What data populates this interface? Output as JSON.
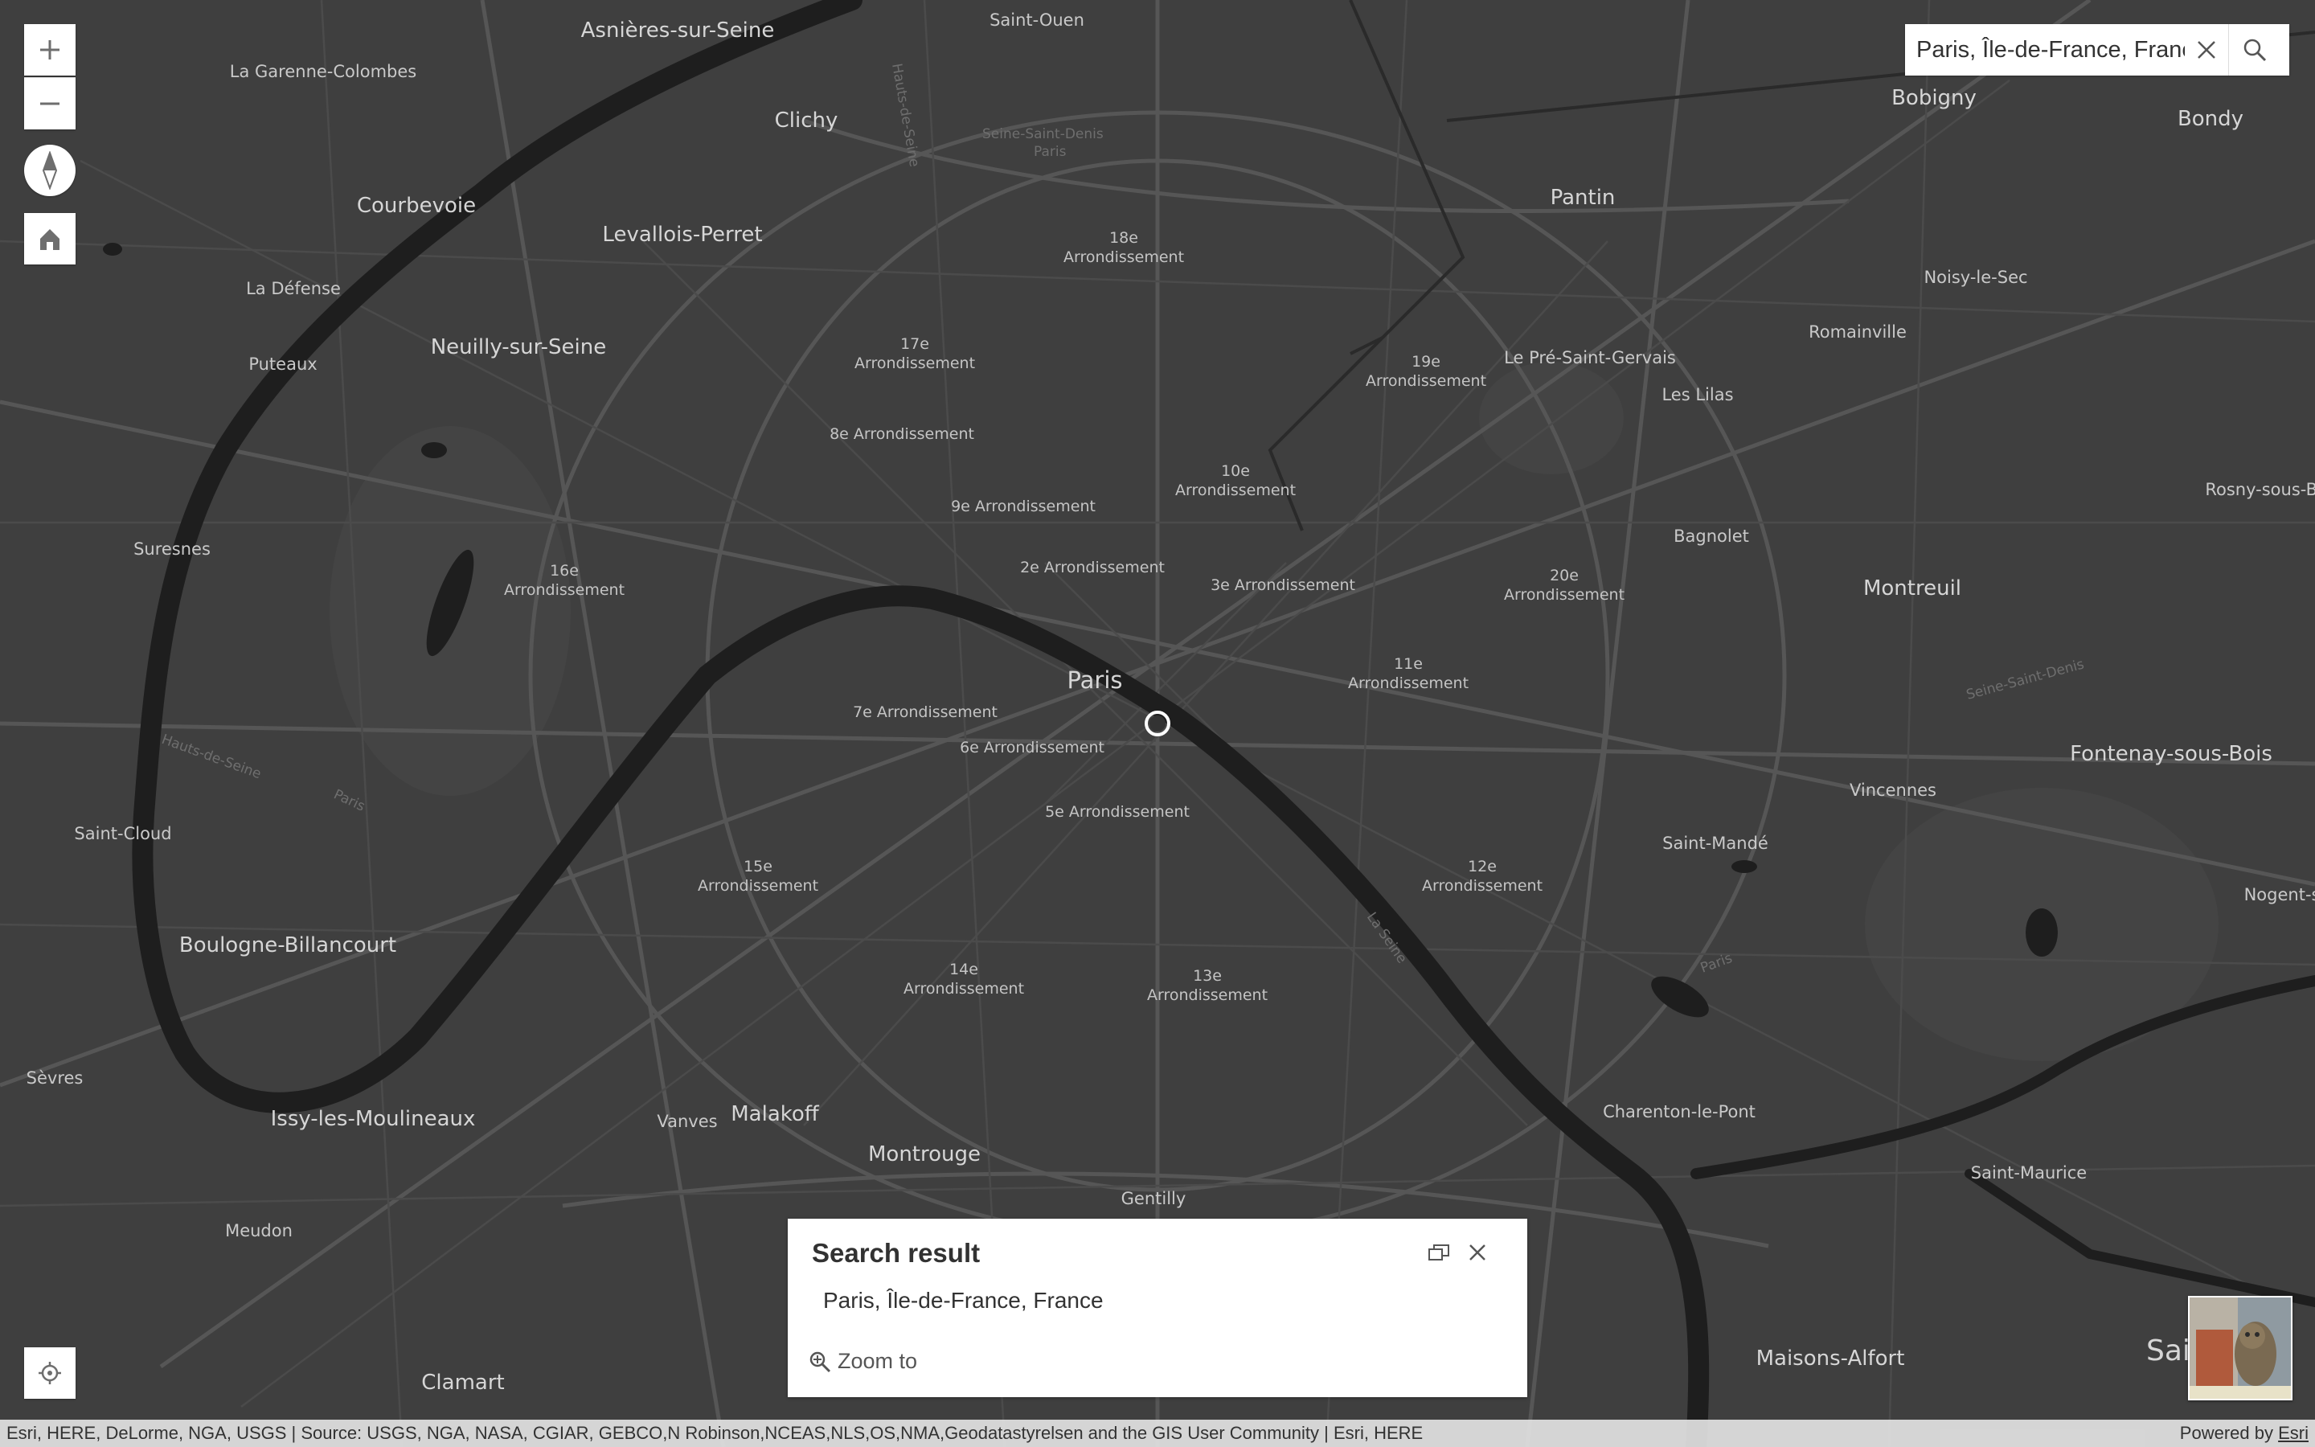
{
  "map": {
    "colors": {
      "background": "#3f3f3f",
      "water": "#1e1e1e",
      "roads": "#555555",
      "label": "#c9c9c9"
    },
    "labels": {
      "asnieres": "Asnières-sur-Seine",
      "saint_ouen": "Saint-Ouen",
      "garenne": "La Garenne-Colombes",
      "clichy": "Clichy",
      "bobigny": "Bobigny",
      "bondy": "Bondy",
      "courbevoie": "Courbevoie",
      "levallois": "Levallois-Perret",
      "pantin": "Pantin",
      "defense": "La Défense",
      "noisy": "Noisy-le-Sec",
      "neuilly": "Neuilly-sur-Seine",
      "puteaux": "Puteaux",
      "pre_st_gervais": "Le Pré-Saint-Gervais",
      "romainville": "Romainville",
      "les_lilas": "Les Lilas",
      "rosny": "Rosny-sous-Bois",
      "suresnes": "Suresnes",
      "bagnolet": "Bagnolet",
      "montreuil": "Montreuil",
      "paris": "Paris",
      "fontenay": "Fontenay-sous-Bois",
      "vincennes": "Vincennes",
      "saint_cloud": "Saint-Cloud",
      "saint_mande": "Saint-Mandé",
      "nogent": "Nogent-sur",
      "boulogne": "Boulogne-Billancourt",
      "sevres": "Sèvres",
      "issy": "Issy-les-Moulineaux",
      "vanves": "Vanves",
      "malakoff": "Malakoff",
      "montrouge": "Montrouge",
      "charenton": "Charenton-le-Pont",
      "saint_maurice": "Saint-Maurice",
      "meudon": "Meudon",
      "gentilly": "Gentilly",
      "maisons_alfort": "Maisons-Alfort",
      "saint_big": "Saint-",
      "clamart": "Clamart",
      "arr_18_a": "18e",
      "arr_18_b": "Arrondissement",
      "arr_17_a": "17e",
      "arr_17_b": "Arrondissement",
      "arr_19_a": "19e",
      "arr_19_b": "Arrondissement",
      "arr_8": "8e Arrondissement",
      "arr_10_a": "10e",
      "arr_10_b": "Arrondissement",
      "arr_9": "9e Arrondissement",
      "arr_16_a": "16e",
      "arr_16_b": "Arrondissement",
      "arr_2": "2e Arrondissement",
      "arr_3": "3e Arrondissement",
      "arr_20_a": "20e",
      "arr_20_b": "Arrondissement",
      "arr_11_a": "11e",
      "arr_11_b": "Arrondissement",
      "arr_7": "7e Arrondissement",
      "arr_6": "6e Arrondissement",
      "arr_5": "5e Arrondissement",
      "arr_15_a": "15e",
      "arr_15_b": "Arrondissement",
      "arr_12_a": "12e",
      "arr_12_b": "Arrondissement",
      "arr_14_a": "14e",
      "arr_14_b": "Arrondissement",
      "arr_13_a": "13e",
      "arr_13_b": "Arrondissement",
      "river_seine_1": "Hauts-de-Seine",
      "river_seine_2": "Seine-Saint-Denis",
      "river_seine_3": "La Seine",
      "river_paris_1": "Paris",
      "river_paris_2": "Paris",
      "river_paris_3": "Paris"
    }
  },
  "controls": {
    "zoom_in": "plus-icon",
    "zoom_out": "minus-icon",
    "compass": "compass-icon",
    "home": "home-icon",
    "locate": "locate-icon"
  },
  "search": {
    "value": "Paris, Île-de-France, France",
    "clear_icon": "close-icon",
    "submit_icon": "search-icon"
  },
  "popup": {
    "title": "Search result",
    "content": "Paris, Île-de-France, France",
    "zoom_label": "Zoom to",
    "dock_icon": "dock-icon",
    "close_icon": "close-icon"
  },
  "basemap_toggle": {
    "icon": "basemap-thumbnail"
  },
  "attribution": {
    "text": "Esri, HERE, DeLorme, NGA, USGS | Source: USGS, NGA, NASA, CGIAR, GEBCO,N Robinson,NCEAS,NLS,OS,NMA,Geodatastyrelsen and the GIS User Community | Esri, HERE",
    "powered_prefix": "Powered by",
    "powered_link": "Esri"
  }
}
